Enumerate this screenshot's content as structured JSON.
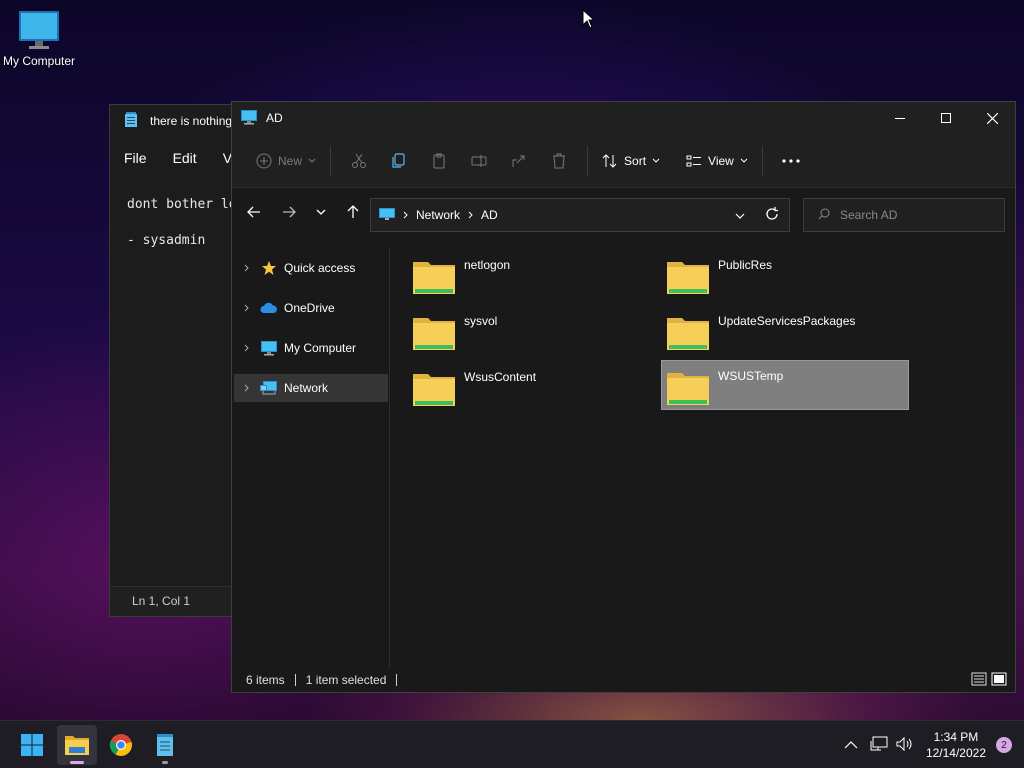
{
  "desktop": {
    "icons": [
      {
        "label": "My Computer",
        "icon": "monitor-icon"
      }
    ]
  },
  "notepad": {
    "title": "there is nothing",
    "menu": [
      "File",
      "Edit",
      "V"
    ],
    "lines": [
      "dont bother lo",
      "- sysadmin"
    ],
    "status": "Ln 1, Col 1"
  },
  "explorer": {
    "title": "AD",
    "toolbar": {
      "new_label": "New",
      "sort_label": "Sort",
      "view_label": "View"
    },
    "address": {
      "segments": [
        "Network",
        "AD"
      ]
    },
    "search": {
      "placeholder": "Search AD"
    },
    "nav_items": [
      {
        "label": "Quick access",
        "icon": "star-icon"
      },
      {
        "label": "OneDrive",
        "icon": "cloud-icon"
      },
      {
        "label": "My Computer",
        "icon": "monitor-icon"
      },
      {
        "label": "Network",
        "icon": "network-icon",
        "selected": true
      }
    ],
    "files": [
      {
        "name": "netlogon"
      },
      {
        "name": "PublicRes"
      },
      {
        "name": "sysvol"
      },
      {
        "name": "UpdateServicesPackages"
      },
      {
        "name": "WsusContent"
      },
      {
        "name": "WSUSTemp",
        "selected": true
      }
    ],
    "status": {
      "items": "6 items",
      "selected": "1 item selected"
    }
  },
  "taskbar": {
    "apps": [
      "start-icon",
      "file-explorer-icon",
      "chrome-icon",
      "notepad-icon"
    ],
    "clock": {
      "time": "1:34 PM",
      "date": "12/14/2022"
    },
    "notification_count": "2"
  },
  "colors": {
    "folder_yellow": "#f5cf58",
    "folder_green": "#3fbf5a",
    "selection_gray": "#7f7f7f",
    "accent_pink": "#e2a4e8"
  }
}
